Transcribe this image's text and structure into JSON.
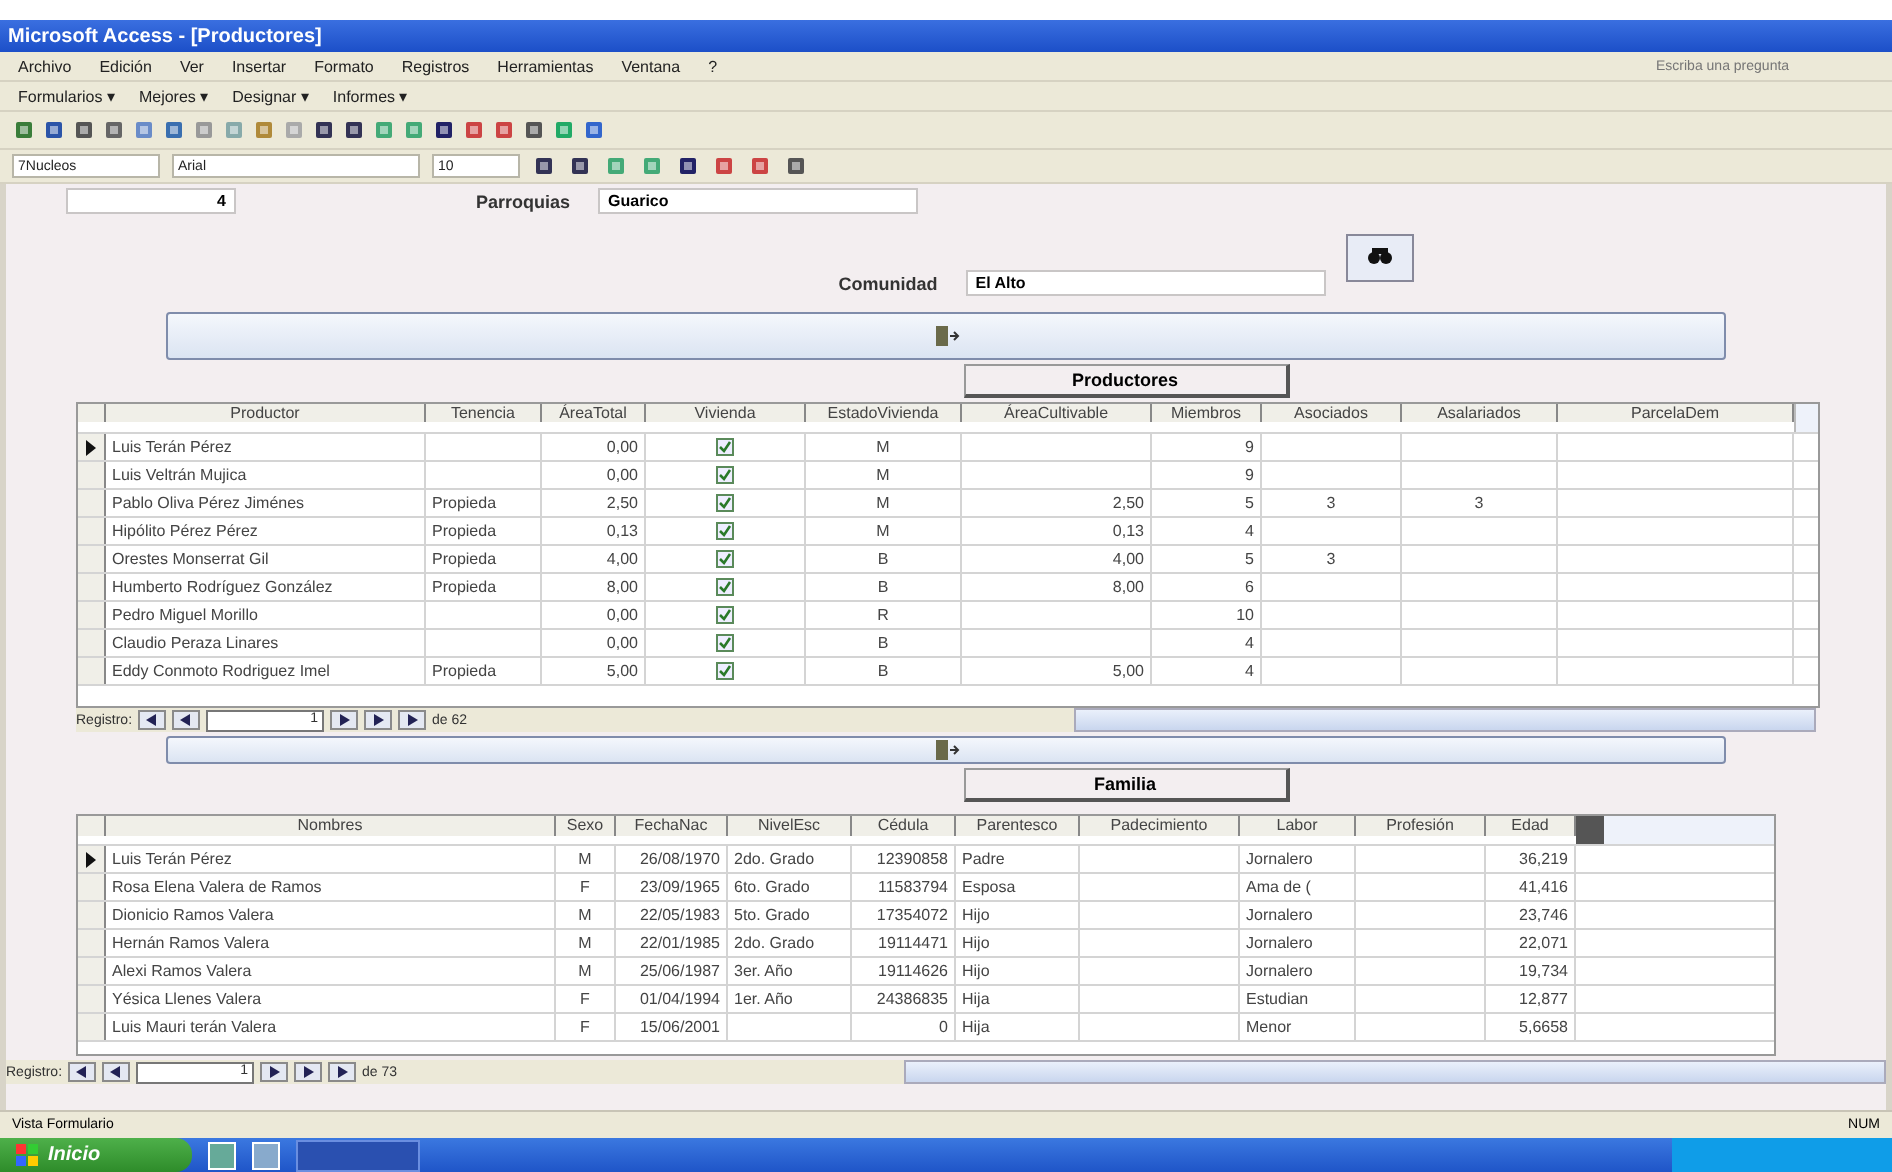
{
  "window": {
    "title": "Microsoft Access - [Productores]"
  },
  "menu": [
    "Archivo",
    "Edición",
    "Ver",
    "Insertar",
    "Formato",
    "Registros",
    "Herramientas",
    "Ventana",
    "?"
  ],
  "help_box": {
    "placeholder": "Escriba una pregunta"
  },
  "links_toolbar": [
    "Formularios ▾",
    "Mejores ▾",
    "Designar ▾",
    "Informes ▾"
  ],
  "format_toolbar": {
    "object": "7Nucleos",
    "font": "Arial",
    "size": "10"
  },
  "form": {
    "top_field": "4",
    "parroquia": {
      "label": "Parroquias",
      "value": "Guarico"
    },
    "comunidad": {
      "label": "Comunidad",
      "value": "El Alto"
    }
  },
  "productores": {
    "title": "Productores",
    "columns": [
      "Productor",
      "Tenencia",
      "ÁreaTotal",
      "Vivienda",
      "EstadoVivienda",
      "ÁreaCultivable",
      "Miembros",
      "Asociados",
      "Asalariados",
      "ParcelaDem"
    ],
    "rows": [
      {
        "selected": true,
        "checked": true,
        "cells": [
          "Luis Terán Pérez",
          "",
          "0,00",
          "",
          "M",
          "",
          "9",
          "",
          "",
          ""
        ]
      },
      {
        "selected": false,
        "checked": true,
        "cells": [
          "Luis  Veltrán Mujica",
          "",
          "0,00",
          "",
          "M",
          "",
          "9",
          "",
          "",
          ""
        ]
      },
      {
        "selected": false,
        "checked": true,
        "cells": [
          "Pablo Oliva Pérez Jiménes",
          "Propieda",
          "2,50",
          "",
          "M",
          "2,50",
          "5",
          "3",
          "3",
          ""
        ]
      },
      {
        "selected": false,
        "checked": true,
        "cells": [
          "Hipólito Pérez Pérez",
          "Propieda",
          "0,13",
          "",
          "M",
          "0,13",
          "4",
          "",
          "",
          ""
        ]
      },
      {
        "selected": false,
        "checked": true,
        "cells": [
          "Orestes Monserrat Gil",
          "Propieda",
          "4,00",
          "",
          "B",
          "4,00",
          "5",
          "3",
          "",
          ""
        ]
      },
      {
        "selected": false,
        "checked": true,
        "cells": [
          "Humberto Rodríguez González",
          "Propieda",
          "8,00",
          "",
          "B",
          "8,00",
          "6",
          "",
          "",
          ""
        ]
      },
      {
        "selected": false,
        "checked": true,
        "cells": [
          "Pedro Miguel Morillo",
          "",
          "0,00",
          "",
          "R",
          "",
          "10",
          "",
          "",
          ""
        ]
      },
      {
        "selected": false,
        "checked": true,
        "cells": [
          "Claudio Peraza Linares",
          "",
          "0,00",
          "",
          "B",
          "",
          "4",
          "",
          "",
          ""
        ]
      },
      {
        "selected": false,
        "checked": true,
        "cells": [
          "Eddy Conmoto Rodriguez Imel",
          "Propieda",
          "5,00",
          "",
          "B",
          "5,00",
          "4",
          "",
          "",
          ""
        ]
      }
    ],
    "nav": {
      "label": "Registro:",
      "current": "1",
      "total": "de 62"
    }
  },
  "familia": {
    "title": "Familia",
    "columns": [
      "Nombres",
      "Sexo",
      "FechaNac",
      "NivelEsc",
      "Cédula",
      "Parentesco",
      "Padecimiento",
      "Labor",
      "Profesión",
      "Edad"
    ],
    "rows": [
      {
        "selected": true,
        "cells": [
          "Luis Terán Pérez",
          "M",
          "26/08/1970",
          "2do. Grado",
          "12390858",
          "Padre",
          "",
          "Jornalero",
          "",
          "36,219"
        ]
      },
      {
        "selected": false,
        "cells": [
          "Rosa Elena Valera de Ramos",
          "F",
          "23/09/1965",
          "6to. Grado",
          "11583794",
          "Esposa",
          "",
          "Ama de (",
          "",
          "41,416"
        ]
      },
      {
        "selected": false,
        "cells": [
          "Dionicio Ramos Valera",
          "M",
          "22/05/1983",
          "5to. Grado",
          "17354072",
          "Hijo",
          "",
          "Jornalero",
          "",
          "23,746"
        ]
      },
      {
        "selected": false,
        "cells": [
          "Hernán Ramos Valera",
          "M",
          "22/01/1985",
          "2do. Grado",
          "19114471",
          "Hijo",
          "",
          "Jornalero",
          "",
          "22,071"
        ]
      },
      {
        "selected": false,
        "cells": [
          "Alexi Ramos Valera",
          "M",
          "25/06/1987",
          "3er. Año",
          "19114626",
          "Hijo",
          "",
          "Jornalero",
          "",
          "19,734"
        ]
      },
      {
        "selected": false,
        "cells": [
          "Yésica Llenes Valera",
          "F",
          "01/04/1994",
          "1er. Año",
          "24386835",
          "Hija",
          "",
          "Estudian",
          "",
          "12,877"
        ]
      },
      {
        "selected": false,
        "cells": [
          "Luis Mauri terán Valera",
          "F",
          "15/06/2001",
          "",
          "0",
          "Hija",
          "",
          "Menor",
          "",
          "5,6658"
        ]
      }
    ],
    "nav": {
      "label": "Registro:",
      "current": "1",
      "total": "de 73"
    }
  },
  "status_bar": {
    "left": "Vista Formulario",
    "right": "NUM"
  },
  "taskbar": {
    "start": "Inicio"
  }
}
